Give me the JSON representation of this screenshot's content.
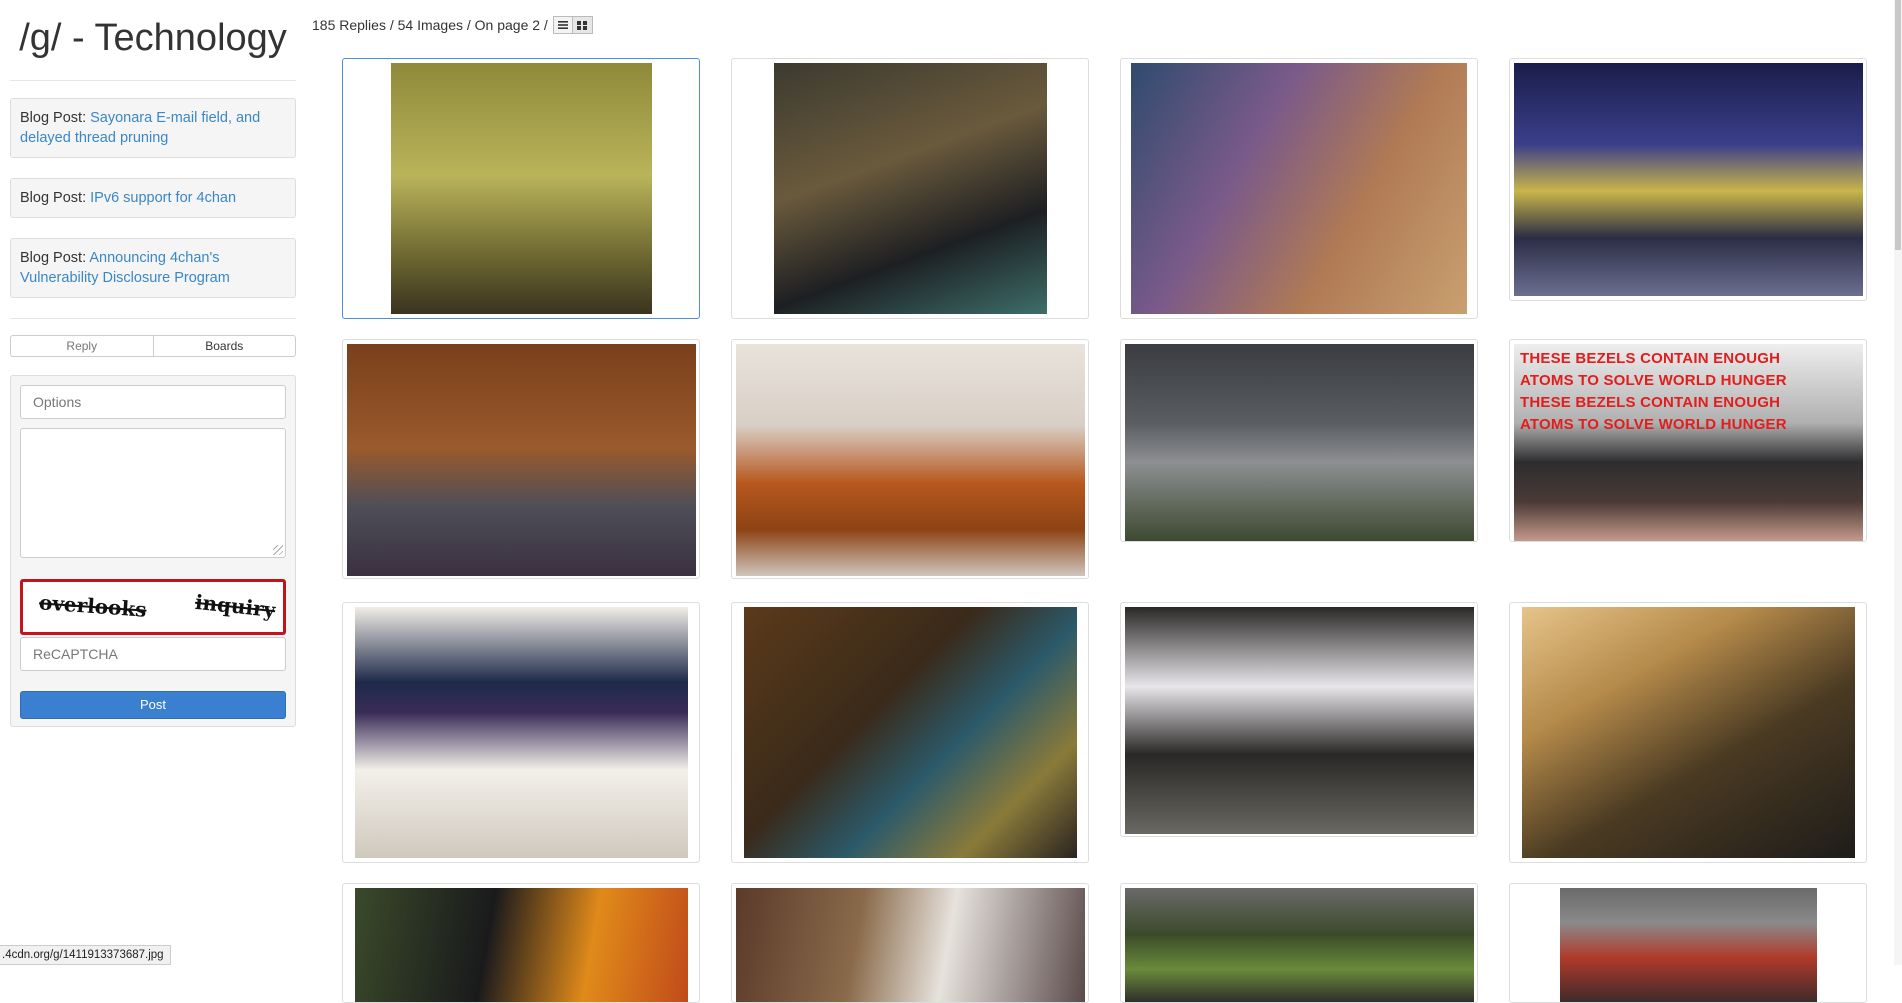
{
  "board": {
    "title": "/g/ - Technology"
  },
  "blog_posts": [
    {
      "prefix": "Blog Post: ",
      "link": "Sayonara E-mail field, and delayed thread pruning"
    },
    {
      "prefix": "Blog Post: ",
      "link": "IPv6 support for 4chan"
    },
    {
      "prefix": "Blog Post: ",
      "link": "Announcing 4chan's Vulnerability Disclosure Program"
    }
  ],
  "tabs": {
    "reply": "Reply",
    "boards": "Boards"
  },
  "form": {
    "options_placeholder": "Options",
    "captcha_words": [
      "overlooks",
      "inquiry"
    ],
    "recaptcha_placeholder": "ReCAPTCHA",
    "post_label": "Post"
  },
  "thread_stats": "185 Replies / 54 Images / On page 2 /",
  "view_buttons": {
    "list_icon": "list-icon",
    "grid_icon": "grid-icon"
  },
  "image_overlay_text": [
    "THESE BEZELS CONTAIN ENOUGH",
    "ATOMS TO SOLVE WORLD HUNGER",
    "THESE BEZELS CONTAIN ENOUGH",
    "ATOMS TO SOLVE WORLD HUNGER"
  ],
  "status_bar": {
    "url": ".4cdn.org/g/1411913373687.jpg"
  },
  "colors": {
    "link": "#3a87c8",
    "post_button": "#3a7fd0",
    "captcha_border": "#c4141b",
    "overlay_text": "#e21d1d"
  }
}
